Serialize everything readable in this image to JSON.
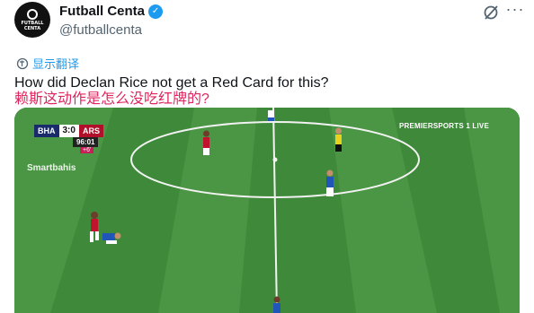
{
  "account": {
    "name": "Futball Centa",
    "handle": "@futballcenta",
    "avatar_text_line1": "FUTBALL",
    "avatar_text_line2": "CENTA"
  },
  "actions": {
    "translate_label": "显示翻译"
  },
  "tweet": {
    "text": "How did Declan Rice not get a Red Card for this?",
    "translation_overlay": "赖斯这动作是怎么没吃红牌的?"
  },
  "video": {
    "home_team": "BHA",
    "away_team": "ARS",
    "score": "3:0",
    "clock": "96:01",
    "added_time": "+6'",
    "sponsor": "Smartbahis",
    "broadcaster": "PREMIERSPORTS 1 LIVE"
  },
  "colors": {
    "accent": "#1d9bf0",
    "text": "#0f1419",
    "muted": "#536471",
    "overlay_red": "#e0245e",
    "pitch_green": "#3f8a3a"
  }
}
